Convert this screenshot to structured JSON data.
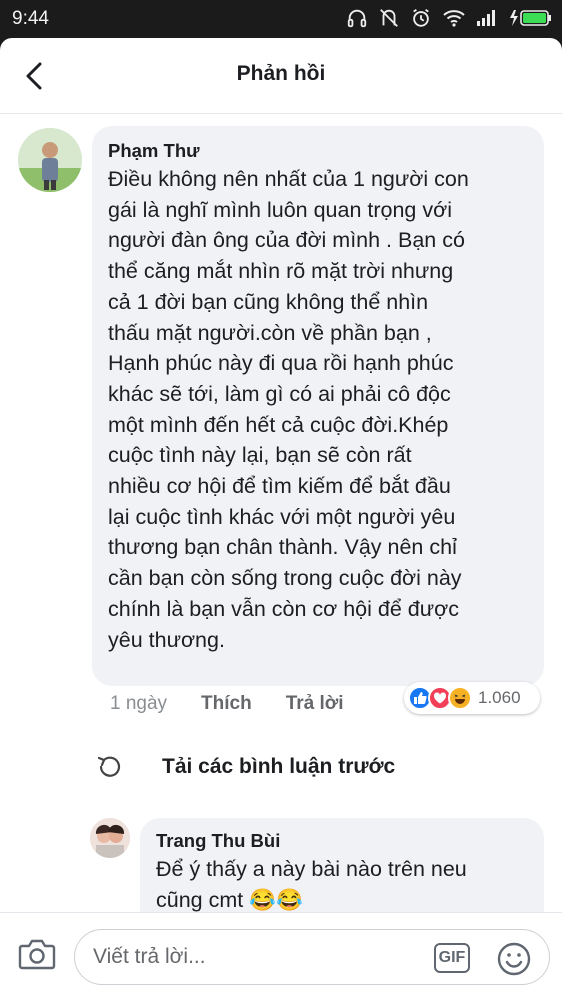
{
  "status_bar": {
    "time": "9:44",
    "icons": [
      "headphones-icon",
      "vibrate-off-icon",
      "alarm-icon",
      "wifi-icon",
      "signal-icon",
      "battery-charging-icon"
    ]
  },
  "header": {
    "title": "Phản hồi",
    "back_icon": "chevron-left-icon"
  },
  "comment": {
    "author": "Phạm Thư",
    "text": "Điều không nên nhất của 1 người con\ngái là  nghĩ mình luôn quan trọng với\nngười đàn ông của đời mình . Bạn có\nthể căng mắt nhìn rõ mặt trời  nhưng\ncả 1 đời bạn cũng không thể nhìn\nthấu mặt người.còn về phần bạn ,\nHạnh phúc này đi qua rồi hạnh phúc\nkhác sẽ tới, làm gì có ai phải cô độc\nmột mình đến hết cả cuộc đời.Khép\ncuộc tình này lại, bạn sẽ còn rất\nnhiều cơ hội để tìm kiếm để bắt đầu\nlại cuộc tình khác với một người yêu\nthương bạn chân thành. Vậy nên chỉ\ncần bạn còn sống trong cuộc đời này\nchính là bạn vẫn còn cơ hội để được\nyêu thương.",
    "time": "1 ngày",
    "like_label": "Thích",
    "reply_label": "Trả lời",
    "reactions": {
      "types": [
        "like-icon",
        "love-icon",
        "haha-icon"
      ],
      "count": "1.060",
      "colors": {
        "like": "#1877f2",
        "love": "#f33e58",
        "haha": "#f7b125"
      }
    }
  },
  "load_previous": {
    "label": "Tải các bình luận trước",
    "icon": "refresh-icon"
  },
  "reply": {
    "author": "Trang Thu Bùi",
    "text": "Để ý thấy a này bài nào trên neu\ncũng cmt"
  },
  "composer": {
    "placeholder": "Viết trả lời...",
    "camera_icon": "camera-icon",
    "gif_label": "GIF",
    "emoji_icon": "smiley-icon"
  }
}
